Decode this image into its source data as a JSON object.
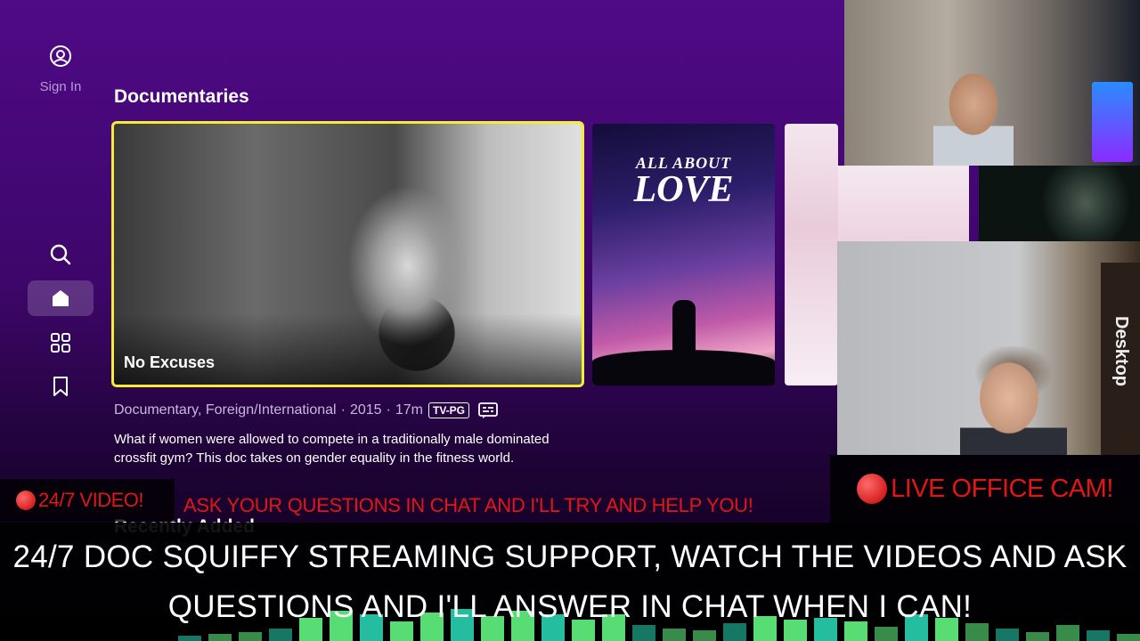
{
  "sidebar": {
    "signin_label": "Sign In",
    "icons": [
      "account-icon",
      "search-icon",
      "home-icon",
      "grid-icon",
      "bookmark-icon"
    ]
  },
  "section": {
    "title": "Documentaries",
    "featured_title": "No Excuses",
    "poster_title_top": "ALL ABOUT",
    "poster_title_main": "LOVE"
  },
  "details": {
    "genres": "Documentary, Foreign/International",
    "year": "2015",
    "duration": "17m",
    "separator": "·",
    "rating": "TV-PG",
    "description": "What if women were allowed to compete in a traditionally male dominated crossfit gym? This doc takes on gender equality in the fitness world."
  },
  "next_section": {
    "title": "Recently Added"
  },
  "overlay": {
    "left_badge": "24/7 VIDEO!",
    "ask_banner": "ASK YOUR QUESTIONS IN CHAT AND I'LL TRY AND HELP YOU!",
    "right_badge": "LIVE OFFICE CAM!",
    "ticker_line1": "24/7 DOC SQUIFFY STREAMING SUPPORT, WATCH THE VIDEOS AND ASK",
    "ticker_line2": "QUESTIONS AND I'LL ANSWER IN CHAT WHEN I CAN!",
    "cam_box_text": "Desktop"
  },
  "colors": {
    "accent_focus": "#f5ec35",
    "overlay_red": "#e31616",
    "viz_green": "#5de87a",
    "viz_teal": "#27c7a8"
  }
}
